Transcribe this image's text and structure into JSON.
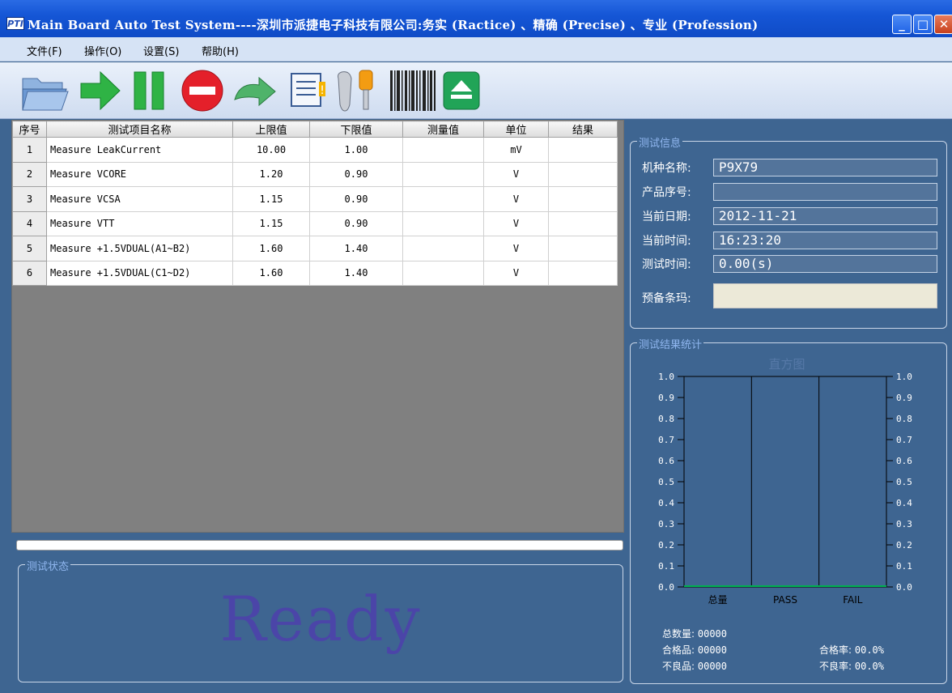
{
  "window": {
    "app_icon": "PTI",
    "title": "Main Board Auto Test System----深圳市派捷电子科技有限公司:务实 (Ractice) 、精确 (Precise) 、专业 (Profession)",
    "buttons": [
      "minimize-icon",
      "maximize-icon",
      "close-icon"
    ]
  },
  "menu": {
    "file": "文件(F)",
    "operate": "操作(O)",
    "settings": "设置(S)",
    "help": "帮助(H)"
  },
  "toolbar": {
    "icons": [
      "folder-open-icon",
      "arrow-right-icon",
      "pause-icon",
      "stop-icon",
      "redo-arrow-icon",
      "log-note-icon",
      "wrench-screwdriver-icon",
      "barcode-icon",
      "eject-icon"
    ]
  },
  "table": {
    "headers": [
      "序号",
      "测试项目名称",
      "上限值",
      "下限值",
      "测量值",
      "单位",
      "结果"
    ],
    "rows": [
      {
        "idx": "1",
        "name": "Measure LeakCurrent",
        "upper": "10.00",
        "lower": "1.00",
        "measured": "",
        "unit": "mV",
        "result": ""
      },
      {
        "idx": "2",
        "name": "Measure VCORE",
        "upper": "1.20",
        "lower": "0.90",
        "measured": "",
        "unit": "V",
        "result": ""
      },
      {
        "idx": "3",
        "name": "Measure VCSA",
        "upper": "1.15",
        "lower": "0.90",
        "measured": "",
        "unit": "V",
        "result": ""
      },
      {
        "idx": "4",
        "name": "Measure VTT",
        "upper": "1.15",
        "lower": "0.90",
        "measured": "",
        "unit": "V",
        "result": ""
      },
      {
        "idx": "5",
        "name": "Measure +1.5VDUAL(A1~B2)",
        "upper": "1.60",
        "lower": "1.40",
        "measured": "",
        "unit": "V",
        "result": ""
      },
      {
        "idx": "6",
        "name": "Measure +1.5VDUAL(C1~D2)",
        "upper": "1.60",
        "lower": "1.40",
        "measured": "",
        "unit": "V",
        "result": ""
      }
    ]
  },
  "progress": {
    "value": 0
  },
  "status": {
    "legend": "测试状态",
    "text": "Ready"
  },
  "info": {
    "legend": "测试信息",
    "model_label": "机种名称:",
    "model_value": "P9X79",
    "serial_label": "产品序号:",
    "serial_value": "",
    "date_label": "当前日期:",
    "date_value": "2012-11-21",
    "time_label": "当前时间:",
    "time_value": "16:23:20",
    "test_time_label": "测试时间:",
    "test_time_value": "0.00(s)",
    "barcode_label": "预备条玛:",
    "barcode_value": ""
  },
  "stats": {
    "legend": "测试结果统计",
    "total_label": "总数量:",
    "total_value": "00000",
    "pass_label": "合格品:",
    "pass_value": "00000",
    "fail_label": "不良品:",
    "fail_value": "00000",
    "pass_rate_label": "合格率:",
    "pass_rate_value": "00.0%",
    "fail_rate_label": "不良率:",
    "fail_rate_value": "00.0%"
  },
  "chart_data": {
    "type": "bar",
    "title": "直方图",
    "categories": [
      "总量",
      "PASS",
      "FAIL"
    ],
    "values": [
      0,
      0,
      0
    ],
    "ylim": [
      0,
      1.0
    ],
    "yticks": [
      "0.0",
      "0.1",
      "0.2",
      "0.3",
      "0.4",
      "0.5",
      "0.6",
      "0.7",
      "0.8",
      "0.9",
      "1.0"
    ],
    "right_axis": true,
    "grid": true,
    "colors": {
      "axis": "#000000",
      "baseline": "#00b050",
      "title": "#5679a8"
    }
  }
}
